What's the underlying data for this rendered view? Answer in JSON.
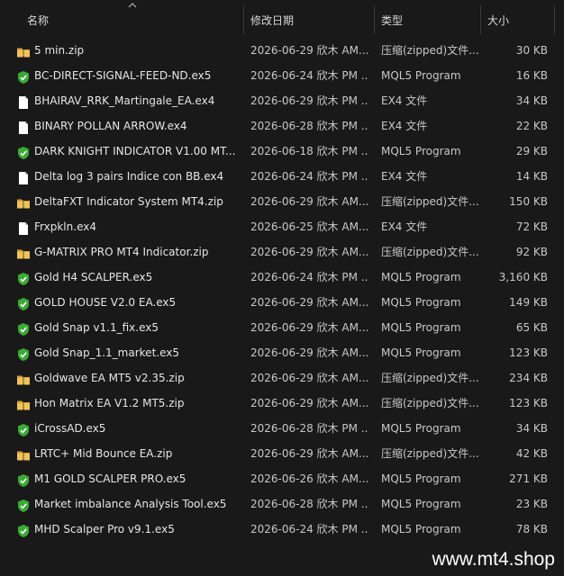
{
  "columns": {
    "name": "名称",
    "date": "修改日期",
    "type": "类型",
    "size": "大小"
  },
  "files": [
    {
      "name": "5 min.zip",
      "date": "2026-06-29 欣木 AM...",
      "type": "压缩(zipped)文件...",
      "size": "30 KB",
      "icon": "zip-folder-icon"
    },
    {
      "name": "BC-DIRECT-SIGNAL-FEED-ND.ex5",
      "date": "2026-06-24 欣木 PM ...",
      "type": "MQL5 Program",
      "size": "16 KB",
      "icon": "mql5-program-icon"
    },
    {
      "name": "BHAIRAV_RRK_Martingale_EA.ex4",
      "date": "2026-06-29 欣木 PM ...",
      "type": "EX4 文件",
      "size": "34 KB",
      "icon": "file-icon"
    },
    {
      "name": "BINARY POLLAN ARROW.ex4",
      "date": "2026-06-28 欣木 PM ...",
      "type": "EX4 文件",
      "size": "22 KB",
      "icon": "file-icon"
    },
    {
      "name": "DARK KNIGHT INDICATOR V1.00 MT...",
      "date": "2026-06-18 欣木 PM ...",
      "type": "MQL5 Program",
      "size": "29 KB",
      "icon": "mql5-program-icon"
    },
    {
      "name": "Delta log 3 pairs  Indice con BB.ex4",
      "date": "2026-06-24 欣木 PM ...",
      "type": "EX4 文件",
      "size": "14 KB",
      "icon": "file-icon"
    },
    {
      "name": "DeltaFXT Indicator System MT4.zip",
      "date": "2026-06-29 欣木 AM...",
      "type": "压缩(zipped)文件...",
      "size": "150 KB",
      "icon": "zip-folder-icon"
    },
    {
      "name": "Frxpkln.ex4",
      "date": "2026-06-25 欣木 AM...",
      "type": "EX4 文件",
      "size": "72 KB",
      "icon": "file-icon"
    },
    {
      "name": "G-MATRIX PRO MT4 Indicator.zip",
      "date": "2026-06-29 欣木 AM...",
      "type": "压缩(zipped)文件...",
      "size": "92 KB",
      "icon": "zip-folder-icon"
    },
    {
      "name": "Gold H4 SCALPER.ex5",
      "date": "2026-06-24 欣木 PM ...",
      "type": "MQL5 Program",
      "size": "3,160 KB",
      "icon": "mql5-program-icon"
    },
    {
      "name": "GOLD HOUSE V2.0 EA.ex5",
      "date": "2026-06-29 欣木 AM...",
      "type": "MQL5 Program",
      "size": "149 KB",
      "icon": "mql5-program-icon"
    },
    {
      "name": "Gold Snap v1.1_fix.ex5",
      "date": "2026-06-29 欣木 AM...",
      "type": "MQL5 Program",
      "size": "65 KB",
      "icon": "mql5-program-icon"
    },
    {
      "name": "Gold Snap_1.1_market.ex5",
      "date": "2026-06-29 欣木 AM...",
      "type": "MQL5 Program",
      "size": "123 KB",
      "icon": "mql5-program-icon"
    },
    {
      "name": "Goldwave EA MT5 v2.35.zip",
      "date": "2026-06-29 欣木 AM...",
      "type": "压缩(zipped)文件...",
      "size": "234 KB",
      "icon": "zip-folder-icon"
    },
    {
      "name": "Hon Matrix EA V1.2 MT5.zip",
      "date": "2026-06-29 欣木 AM...",
      "type": "压缩(zipped)文件...",
      "size": "123 KB",
      "icon": "zip-folder-icon"
    },
    {
      "name": "iCrossAD.ex5",
      "date": "2026-06-28 欣木 PM ...",
      "type": "MQL5 Program",
      "size": "34 KB",
      "icon": "mql5-program-icon"
    },
    {
      "name": "LRTC+ Mid Bounce EA.zip",
      "date": "2026-06-29 欣木 AM...",
      "type": "压缩(zipped)文件...",
      "size": "42 KB",
      "icon": "zip-folder-icon"
    },
    {
      "name": "M1 GOLD SCALPER PRO.ex5",
      "date": "2026-06-26 欣木 AM...",
      "type": "MQL5 Program",
      "size": "271 KB",
      "icon": "mql5-program-icon"
    },
    {
      "name": "Market imbalance Analysis Tool.ex5",
      "date": "2026-06-28 欣木 PM ...",
      "type": "MQL5 Program",
      "size": "23 KB",
      "icon": "mql5-program-icon"
    },
    {
      "name": "MHD Scalper Pro v9.1.ex5",
      "date": "2026-06-24 欣木 PM ...",
      "type": "MQL5 Program",
      "size": "78 KB",
      "icon": "mql5-program-icon"
    }
  ],
  "watermark": "www.mt4.shop",
  "colors": {
    "background": "#191919",
    "zip_folder": "#e8b94a",
    "mql5_shield": "#3aaa35",
    "file": "#ffffff"
  }
}
